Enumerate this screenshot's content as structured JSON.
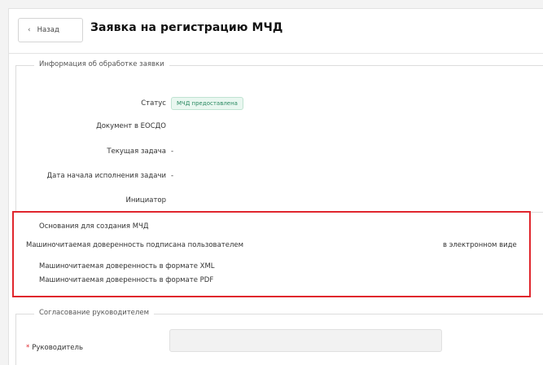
{
  "header": {
    "back_label": "Назад",
    "back_icon": "chevron-left-icon",
    "title": "Заявка на регистрацию МЧД"
  },
  "processing": {
    "legend": "Информация об обработке заявки",
    "status_label": "Статус",
    "status_value": "МЧД предоставлена",
    "document_label": "Документ в ЕОСДО",
    "task_label": "Текущая задача",
    "task_value": "-",
    "task_start_label": "Дата начала исполнения задачи",
    "task_start_value": "-",
    "initiator_label": "Инициатор"
  },
  "basis": {
    "title": "Основания для создания МЧД",
    "signed_label": "Машиночитаемая доверенность подписана пользователем",
    "signed_value": "в электронном виде",
    "xml_label": "Машиночитаемая доверенность в формате XML",
    "pdf_label": "Машиночитаемая доверенность в формате PDF"
  },
  "approval": {
    "legend": "Согласование руководителем",
    "required_mark": "*",
    "manager_label": "Руководитель",
    "manager_value": ""
  },
  "colors": {
    "highlight": "#e0262d",
    "status_text": "#2b8a62",
    "status_bg": "#e9f7f0"
  }
}
